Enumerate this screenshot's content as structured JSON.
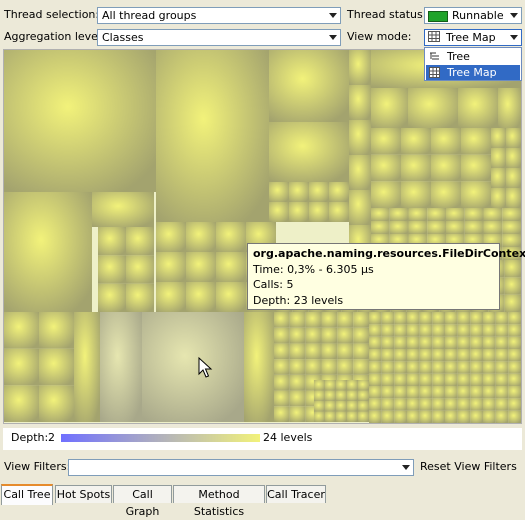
{
  "toolbar": {
    "thread_selection_label": "Thread selection:",
    "thread_selection_value": "All thread groups",
    "thread_status_label": "Thread status:",
    "thread_status_value": "Runnable",
    "aggregation_label": "Aggregation level:",
    "aggregation_value": "Classes",
    "view_mode_label": "View mode:",
    "view_mode_value": "Tree Map"
  },
  "view_mode_options": [
    {
      "label": "Tree",
      "icon": "tree-icon",
      "selected": false
    },
    {
      "label": "Tree Map",
      "icon": "grid-icon",
      "selected": true
    }
  ],
  "tooltip": {
    "title": "org.apache.naming.resources.FileDirContext",
    "time": "Time: 0,3% - 6.305 µs",
    "calls": "Calls: 5",
    "depth": "Depth: 23 levels"
  },
  "depth_legend": {
    "label": "Depth:",
    "min": "2",
    "max": "24 levels",
    "color_start": "#7070ff",
    "color_end": "#f2f27a"
  },
  "filters": {
    "label": "View Filters:",
    "value": "",
    "reset_label": "Reset View Filters"
  },
  "tabs": [
    {
      "label": "Call Tree",
      "active": true
    },
    {
      "label": "Hot Spots",
      "active": false
    },
    {
      "label": "Call Graph",
      "active": false
    },
    {
      "label": "Method Statistics",
      "active": false
    },
    {
      "label": "Call Tracer",
      "active": false
    }
  ],
  "colors": {
    "treemap_light": "#f2f27a",
    "treemap_dark": "#a3a36e",
    "selection": "#316ac5",
    "status_green": "#1fa32a"
  }
}
